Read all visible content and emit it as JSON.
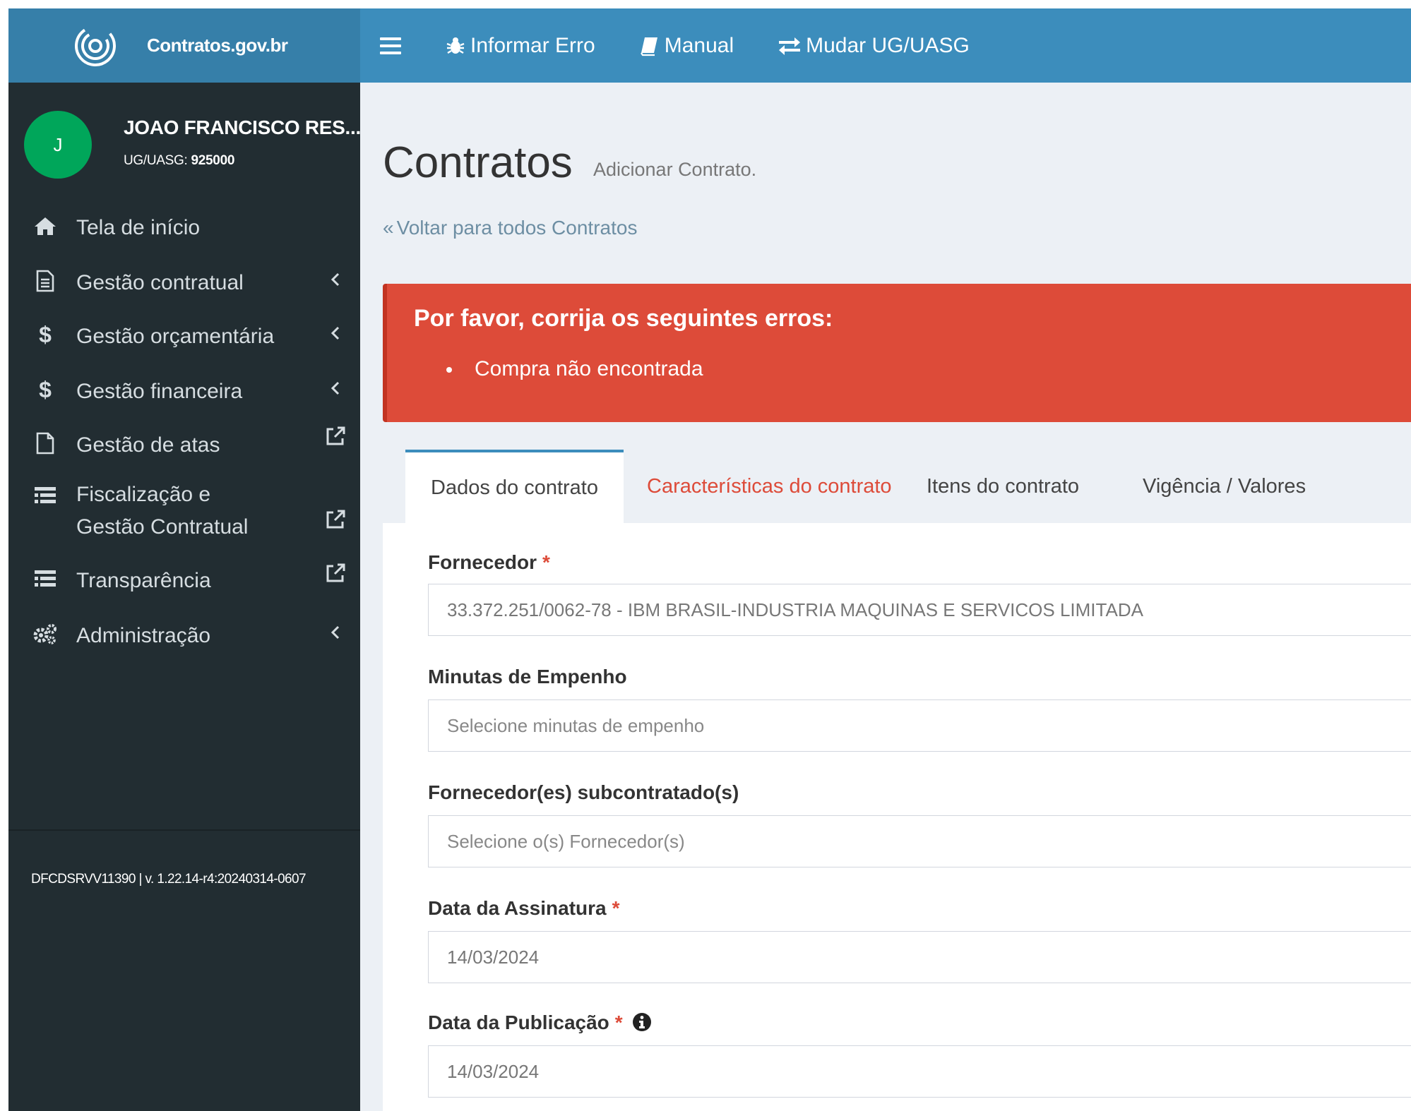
{
  "app": {
    "brand": "Contratos.gov.br"
  },
  "topnav": {
    "items": [
      {
        "label": "Informar Erro",
        "icon": "bug-icon"
      },
      {
        "label": "Manual",
        "icon": "book-icon"
      },
      {
        "label": "Mudar UG/UASG",
        "icon": "exchange-icon"
      }
    ]
  },
  "user": {
    "initial": "J",
    "name": "JOAO FRANCISCO RES...",
    "ug_label": "UG/UASG:",
    "ug_value": "925000"
  },
  "sidebar": {
    "items": [
      {
        "label": "Tela de início",
        "icon": "home-icon"
      },
      {
        "label": "Gestão contratual",
        "icon": "document-icon",
        "right": "chevron-left-icon"
      },
      {
        "label": "Gestão orçamentária",
        "icon": "dollar-icon",
        "right": "chevron-left-icon"
      },
      {
        "label": "Gestão financeira",
        "icon": "dollar-icon",
        "right": "chevron-left-icon"
      },
      {
        "label": "Gestão de atas",
        "icon": "file-icon",
        "right": "external-link-icon"
      },
      {
        "label_line1": "Fiscalização e",
        "label_line2": "Gestão Contratual",
        "icon": "list-icon",
        "right": "external-link-icon"
      },
      {
        "label": "Transparência",
        "icon": "list-icon",
        "right": "external-link-icon"
      },
      {
        "label": "Administração",
        "icon": "cogs-icon",
        "right": "chevron-left-icon"
      }
    ],
    "footer": "DFCDSRVV11390 | v. 1.22.14-r4:20240314-0607"
  },
  "page": {
    "title": "Contratos",
    "subtitle": "Adicionar Contrato.",
    "back_link": "Voltar para todos Contratos"
  },
  "alert": {
    "title": "Por favor, corrija os seguintes erros:",
    "errors": [
      "Compra não encontrada"
    ],
    "color": "#dd4b39"
  },
  "tabs": [
    {
      "label": "Dados do contrato",
      "state": "active"
    },
    {
      "label": "Características do contrato",
      "state": "error"
    },
    {
      "label": "Itens do contrato",
      "state": "normal"
    },
    {
      "label": "Vigência / Valores",
      "state": "normal"
    }
  ],
  "form": {
    "fornecedor": {
      "label": "Fornecedor",
      "value": "33.372.251/0062-78 - IBM BRASIL-INDUSTRIA MAQUINAS E SERVICOS LIMITADA"
    },
    "minutas": {
      "label": "Minutas de Empenho",
      "placeholder": "Selecione minutas de empenho"
    },
    "subcontratados": {
      "label": "Fornecedor(es) subcontratado(s)",
      "placeholder": "Selecione o(s) Fornecedor(s)"
    },
    "data_assinatura": {
      "label": "Data da Assinatura",
      "value": "14/03/2024"
    },
    "data_publicacao": {
      "label": "Data da Publicação",
      "value": "14/03/2024"
    },
    "required_mark": "*"
  },
  "colors": {
    "topbar": "#3c8dbc",
    "brand_bg": "#367fa9",
    "sidebar": "#222d32",
    "avatar": "#00a65a",
    "content_bg": "#ecf0f5"
  }
}
